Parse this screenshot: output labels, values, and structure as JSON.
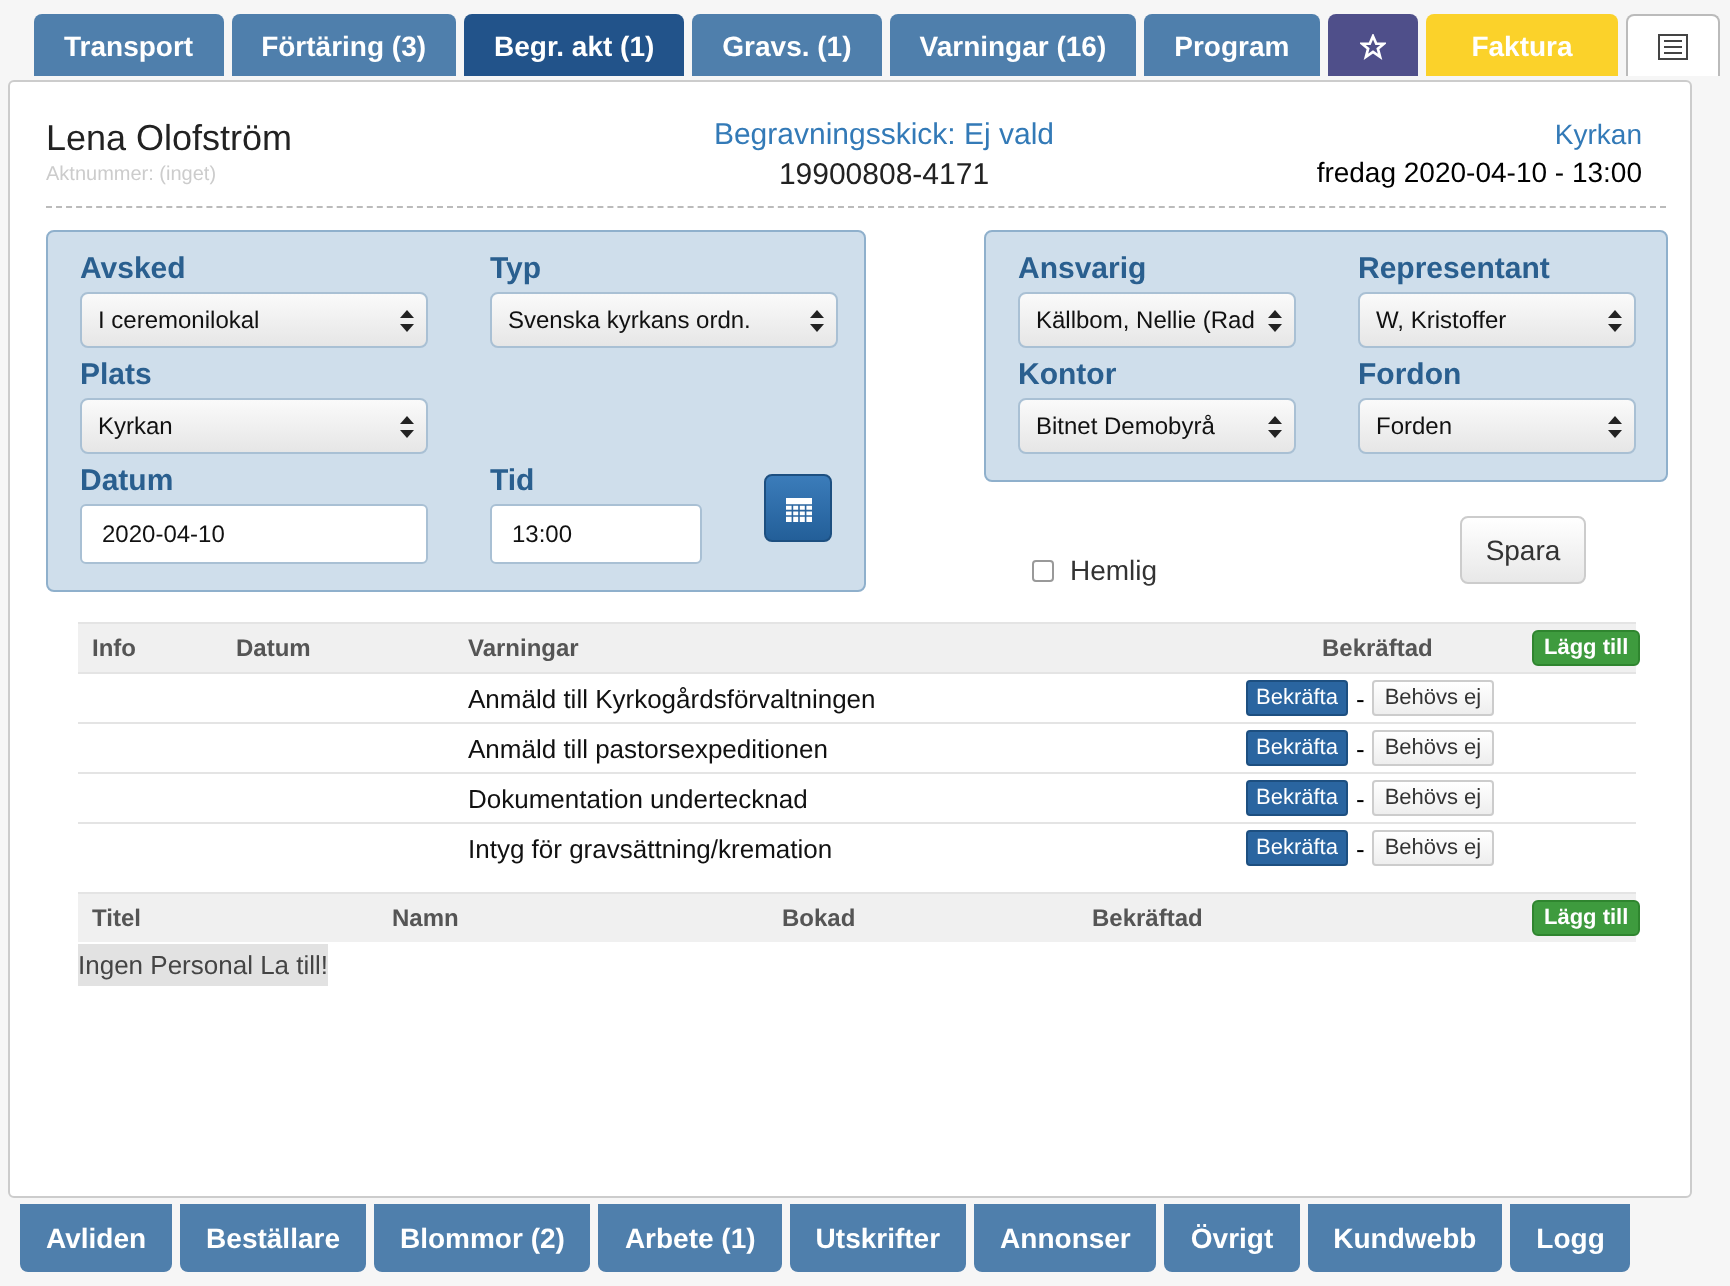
{
  "tabs": [
    {
      "label": "Transport",
      "kind": "text",
      "selected": false
    },
    {
      "label": "Förtäring (3)",
      "kind": "text",
      "selected": false
    },
    {
      "label": "Begr. akt (1)",
      "kind": "text",
      "selected": true
    },
    {
      "label": "Gravs. (1)",
      "kind": "text",
      "selected": false
    },
    {
      "label": "Varningar (16)",
      "kind": "text",
      "selected": false
    },
    {
      "label": "Program",
      "kind": "text",
      "selected": false
    },
    {
      "kind": "star",
      "selected": false
    },
    {
      "label": "Faktura",
      "kind": "invoice",
      "selected": false
    },
    {
      "kind": "list",
      "selected": false
    }
  ],
  "header": {
    "name": "Lena Olofström",
    "case_number": "Aktnummer: (inget)",
    "funeral_type": "Begravningsskick: Ej vald",
    "id_number": "19900808-4171",
    "place": "Kyrkan",
    "datetime": "fredag 2020-04-10 - 13:00"
  },
  "left_panel": {
    "rows": [
      [
        {
          "label": "Avsked",
          "kind": "select",
          "value": "I ceremonilokal"
        },
        {
          "label": "Typ",
          "kind": "select",
          "value": "Svenska kyrkans ordn."
        }
      ],
      [
        {
          "label": "Plats",
          "kind": "select",
          "value": "Kyrkan"
        }
      ],
      [
        {
          "label": "Datum",
          "kind": "input",
          "value": "2020-04-10"
        },
        {
          "label": "Tid",
          "kind": "input",
          "value": "13:00"
        }
      ]
    ]
  },
  "right_panel": {
    "rows": [
      [
        {
          "label": "Ansvarig",
          "kind": "select",
          "value": "Källbom, Nellie (Rad"
        },
        {
          "label": "Representant",
          "kind": "select",
          "value": "W, Kristoffer"
        }
      ],
      [
        {
          "label": "Kontor",
          "kind": "select",
          "value": "Bitnet Demobyrå"
        },
        {
          "label": "Fordon",
          "kind": "select",
          "value": "Forden"
        }
      ]
    ]
  },
  "secret": {
    "label": "Hemlig",
    "checked": false
  },
  "save_button": "Spara",
  "warnings": {
    "columns": [
      "Info",
      "Datum",
      "Varningar",
      "Bekräftad"
    ],
    "add_button": "Lägg till",
    "rows": [
      {
        "text": "Anmäld till Kyrkogårdsförvaltningen",
        "confirm": "Bekräfta",
        "separator": "-",
        "not_needed": "Behövs ej"
      },
      {
        "text": "Anmäld till pastorsexpeditionen",
        "confirm": "Bekräfta",
        "separator": "-",
        "not_needed": "Behövs ej"
      },
      {
        "text": "Dokumentation undertecknad",
        "confirm": "Bekräfta",
        "separator": "-",
        "not_needed": "Behövs ej"
      },
      {
        "text": "Intyg för gravsättning/kremation",
        "confirm": "Bekräfta",
        "separator": "-",
        "not_needed": "Behövs ej"
      }
    ]
  },
  "personnel": {
    "columns": [
      "Titel",
      "Namn",
      "Bokad",
      "Bekräftad"
    ],
    "add_button": "Lägg till",
    "empty_text": "Ingen Personal La till!"
  },
  "bottom_tabs": [
    {
      "label": "Avliden"
    },
    {
      "label": "Beställare"
    },
    {
      "label": "Blommor (2)"
    },
    {
      "label": "Arbete (1)"
    },
    {
      "label": "Utskrifter"
    },
    {
      "label": "Annonser"
    },
    {
      "label": "Övrigt"
    },
    {
      "label": "Kundwebb"
    },
    {
      "label": "Logg"
    }
  ]
}
